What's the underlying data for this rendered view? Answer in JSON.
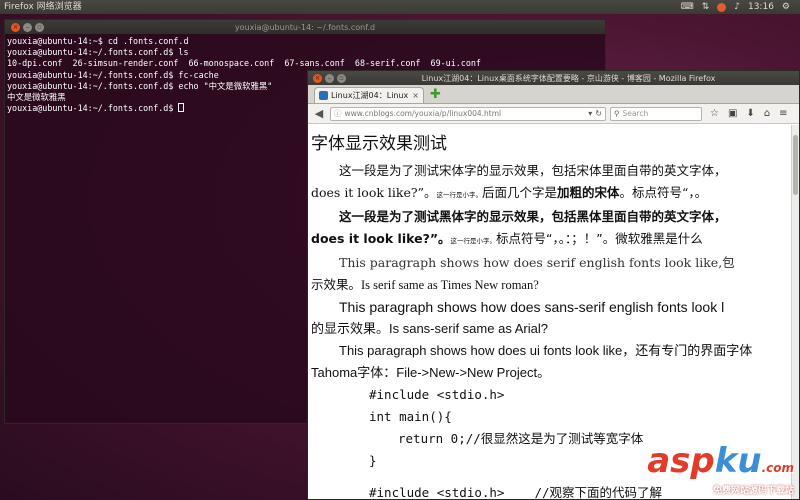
{
  "panel": {
    "app_title": "Firefox 网络浏览器",
    "clock": "13:16"
  },
  "terminal": {
    "title": "youxia@ubuntu-14: ~/.fonts.conf.d",
    "lines": [
      "youxia@ubuntu-14:~$ cd .fonts.conf.d",
      "youxia@ubuntu-14:~/.fonts.conf.d$ ls",
      "10-dpi.conf  26-simsun-render.conf  66-monospace.conf  67-sans.conf  68-serif.conf  69-ui.conf",
      "youxia@ubuntu-14:~/.fonts.conf.d$ fc-cache",
      "youxia@ubuntu-14:~/.fonts.conf.d$ echo \"中文是微软雅黑\"",
      "中文是微软雅黑",
      "youxia@ubuntu-14:~/.fonts.conf.d$ "
    ]
  },
  "firefox": {
    "window_title": "Linux江湖04：Linux桌面系统字体配置要略 - 京山游侠 - 博客园 - Mozilla Firefox",
    "tab_label": "Linux江湖04：Linux...",
    "tab_close": "×",
    "new_tab": "✚",
    "url": "www.cnblogs.com/youxia/p/linux004.html",
    "search_placeholder": "Search"
  },
  "page": {
    "heading": "字体显示效果测试",
    "p1a": "这一段是为了测试宋体字的显示效果，包括宋体里面自带的英文字体，",
    "p1b": "does it look like?”。",
    "p1b_small": "这一行是小字。",
    "p1b_rest": "后面几个字是",
    "p1b_bold": "加粗的宋体",
    "p1b_end": "。标点符号“，。",
    "p2a": "这一段是为了测试黑体字的显示效果，包括黑体里面自带的英文字体，",
    "p2b": "does it look like?”。",
    "p2b_small": "这一行是小字。",
    "p2b_rest": "标点符号“，。：；！”。微软雅黑是什么",
    "p3a": "This paragraph shows how does serif english fonts look like,包",
    "p3b": "示效果。",
    "p3b_rest": "Is serif same as Times New roman?",
    "p4a": "This paragraph shows how does sans-serif english fonts look l",
    "p4b": "的显示效果。Is sans-serif same as Arial?",
    "p5a": "This paragraph shows how does ui fonts look like，还有专门的界面字体",
    "p5b": "Tahoma字体：File->New->New Project。",
    "code1": "#include <stdio.h>",
    "code2": "int main(){",
    "code3": "return 0;//很显然这是为了测试等宽字体",
    "code4": "}",
    "code5": "#include <stdio.h>",
    "code5_comment": "//观察下面的代码了解"
  },
  "watermark": {
    "asp": "asp",
    "ku": "ku",
    "com": ".com",
    "sub": "免费网站源码下载站"
  }
}
